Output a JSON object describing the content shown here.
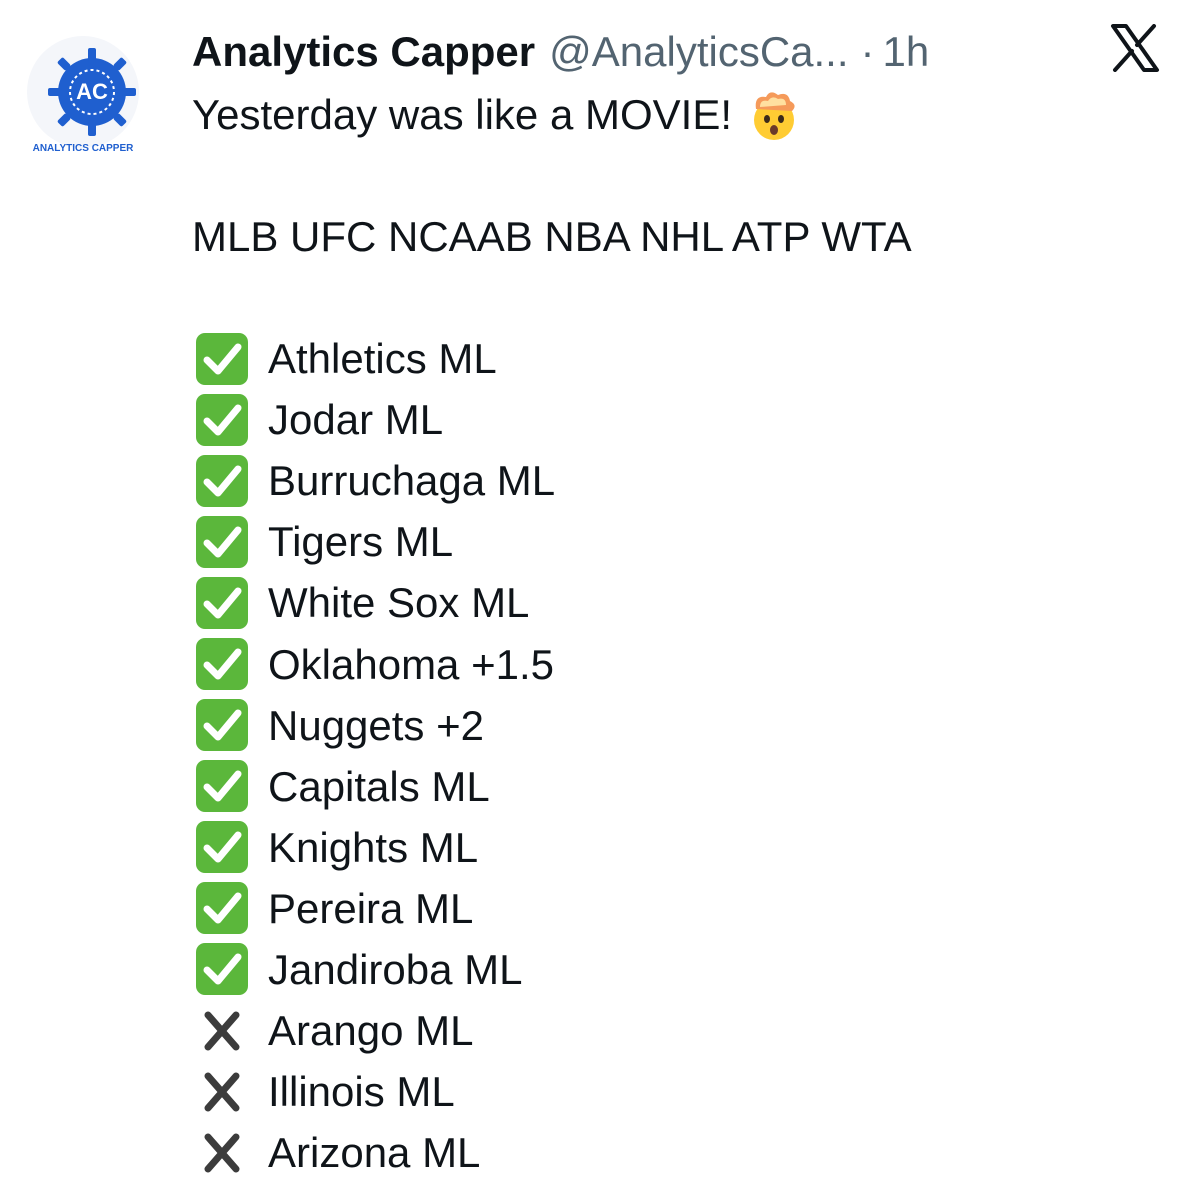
{
  "author": {
    "display_name": "Analytics Capper",
    "handle": "@AnalyticsCa...",
    "separator": "·",
    "time": "1h",
    "avatar_initials": "AC",
    "avatar_caption": "ANALYTICS CAPPER"
  },
  "tweet": {
    "headline": "Yesterday was like a MOVIE!",
    "headline_emoji": "exploding-head-emoji",
    "sports": "MLB UFC NCAAB NBA NHL ATP WTA",
    "picks": [
      {
        "result": "win",
        "text": "Athletics ML"
      },
      {
        "result": "win",
        "text": "Jodar ML"
      },
      {
        "result": "win",
        "text": "Burruchaga ML"
      },
      {
        "result": "win",
        "text": "Tigers ML"
      },
      {
        "result": "win",
        "text": "White Sox ML"
      },
      {
        "result": "win",
        "text": "Oklahoma +1.5"
      },
      {
        "result": "win",
        "text": "Nuggets +2"
      },
      {
        "result": "win",
        "text": "Capitals ML"
      },
      {
        "result": "win",
        "text": "Knights ML"
      },
      {
        "result": "win",
        "text": "Pereira ML"
      },
      {
        "result": "win",
        "text": "Jandiroba ML"
      },
      {
        "result": "loss",
        "text": "Arango ML"
      },
      {
        "result": "loss",
        "text": "Illinois ML"
      },
      {
        "result": "loss",
        "text": "Arizona ML"
      }
    ]
  },
  "icons": {
    "win": "check-mark-button-icon",
    "loss": "cross-mark-icon",
    "brand": "x-logo-icon"
  },
  "colors": {
    "win_green": "#5bb73b",
    "loss_gray": "#3c3c3c",
    "avatar_blue": "#1f5fcf",
    "muted_text": "#536471"
  }
}
